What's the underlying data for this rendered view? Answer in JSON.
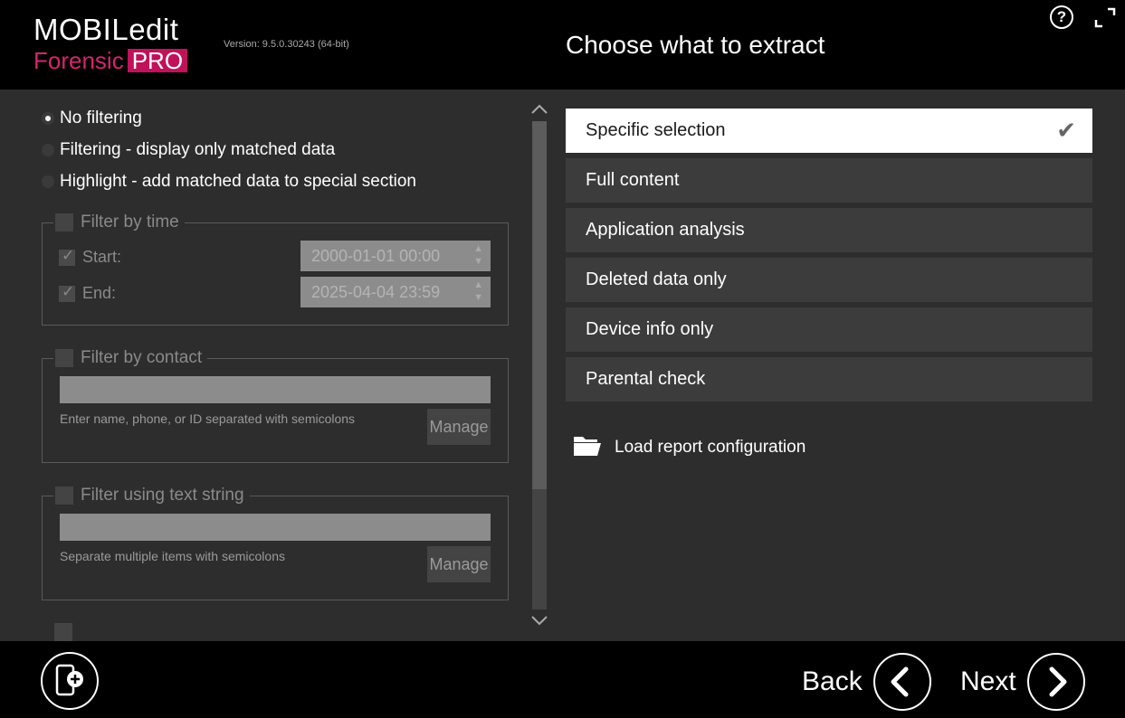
{
  "header": {
    "logo_line1": "MOBILedit",
    "logo_line2": "Forensic",
    "logo_pro": "PRO",
    "version": "Version: 9.5.0.30243 (64-bit)",
    "title": "Choose what to extract",
    "help_label": "?"
  },
  "filters": {
    "radios": [
      {
        "label": "No filtering",
        "selected": true
      },
      {
        "label": "Filtering - display only matched data",
        "selected": false
      },
      {
        "label": "Highlight - add matched data to special section",
        "selected": false
      }
    ],
    "time": {
      "legend": "Filter by time",
      "start_label": "Start:",
      "start_value": "2000-01-01 00:00",
      "end_label": "End:",
      "end_value": "2025-04-04 23:59"
    },
    "contact": {
      "legend": "Filter by contact",
      "hint": "Enter name, phone, or ID separated with semicolons",
      "manage_label": "Manage"
    },
    "text": {
      "legend": "Filter using text string",
      "hint": "Separate multiple items with semicolons",
      "manage_label": "Manage"
    }
  },
  "options": [
    {
      "label": "Specific selection",
      "selected": true
    },
    {
      "label": "Full content",
      "selected": false
    },
    {
      "label": "Application analysis",
      "selected": false
    },
    {
      "label": "Deleted data only",
      "selected": false
    },
    {
      "label": "Device info only",
      "selected": false
    },
    {
      "label": "Parental check",
      "selected": false
    }
  ],
  "load_config_label": "Load report configuration",
  "footer": {
    "back_label": "Back",
    "next_label": "Next"
  },
  "colors": {
    "accent": "#c0125a",
    "background": "#2d2d2d"
  }
}
